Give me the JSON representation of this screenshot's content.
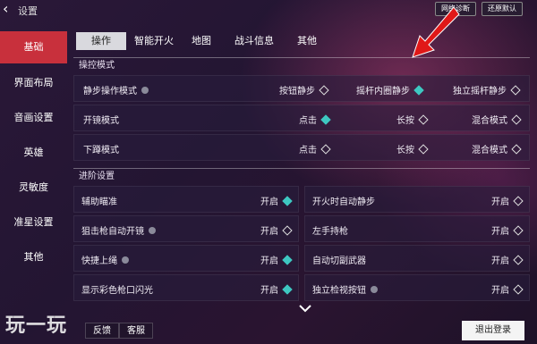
{
  "header": {
    "title": "设置",
    "btn_diag": "网络诊断",
    "btn_reset": "还原默认"
  },
  "sidebar": {
    "items": [
      {
        "label": "基础"
      },
      {
        "label": "界面布局"
      },
      {
        "label": "音画设置"
      },
      {
        "label": "英雄"
      },
      {
        "label": "灵敏度"
      },
      {
        "label": "准星设置"
      },
      {
        "label": "其他"
      }
    ]
  },
  "tabs": [
    {
      "label": "操作"
    },
    {
      "label": "智能开火"
    },
    {
      "label": "地图"
    },
    {
      "label": "战斗信息"
    },
    {
      "label": "其他"
    }
  ],
  "sections": {
    "control": "操控模式",
    "advanced": "进阶设置"
  },
  "control_rows": [
    {
      "label": "静步操作模式",
      "opts": [
        "按钮静步",
        "摇杆内圈静步",
        "独立摇杆静步"
      ],
      "selected": 1
    },
    {
      "label": "开镜模式",
      "opts": [
        "点击",
        "长按",
        "混合模式"
      ],
      "selected": 0
    },
    {
      "label": "下蹲模式",
      "opts": [
        "点击",
        "长按",
        "混合模式"
      ],
      "selected": -1
    }
  ],
  "advanced_rows": [
    {
      "label": "辅助瞄准",
      "value": "开启",
      "on": true
    },
    {
      "label": "开火时自动静步",
      "value": "开启",
      "on": false
    },
    {
      "label": "狙击枪自动开镜",
      "value": "开启",
      "on": false
    },
    {
      "label": "左手持枪",
      "value": "开启",
      "on": false
    },
    {
      "label": "快捷上绳",
      "value": "开启",
      "on": true
    },
    {
      "label": "自动切副武器",
      "value": "开启",
      "on": false
    },
    {
      "label": "显示彩色枪口闪光",
      "value": "开启",
      "on": true
    },
    {
      "label": "独立检视按钮",
      "value": "开启",
      "on": false
    }
  ],
  "footer": {
    "feedback": "反馈",
    "service": "客服",
    "logout": "退出登录",
    "watermark": "玩一玩"
  },
  "colors": {
    "accent_active": "#c8303c",
    "checked": "#3ec7c1",
    "arrow": "#e01818"
  }
}
